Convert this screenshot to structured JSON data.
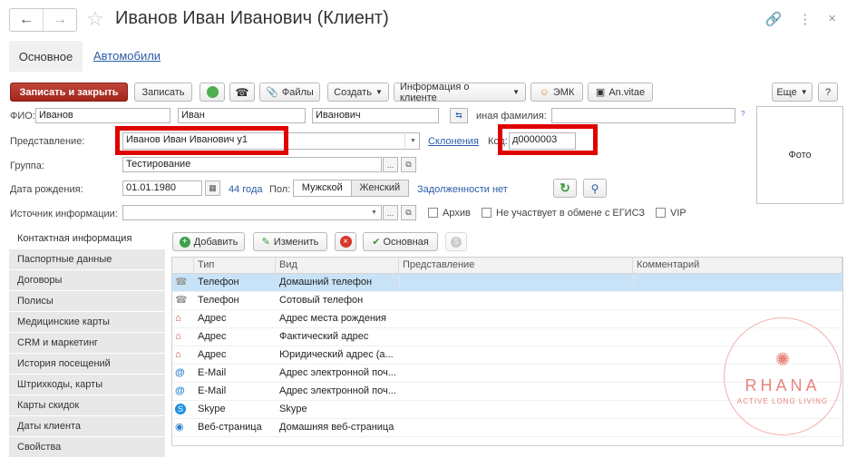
{
  "header": {
    "title": "Иванов Иван Иванович (Клиент)",
    "back_icon": "arrow-left",
    "forward_icon": "arrow-right",
    "favorite_icon": "star",
    "link_icon": "link",
    "more_icon": "vertical-dots",
    "close_icon": "close"
  },
  "tabs": {
    "main": "Основное",
    "cars": "Автомобили"
  },
  "toolbar": {
    "save_close": "Записать и закрыть",
    "save": "Записать",
    "files": "Файлы",
    "create": "Создать",
    "client_info": "Информация о клиенте",
    "emk": "ЭМК",
    "anvitae": "An.vitae",
    "more": "Еще",
    "help": "?"
  },
  "form": {
    "fio_label": "ФИО:",
    "last_name": "Иванов",
    "first_name": "Иван",
    "middle_name": "Иванович",
    "other_surname_label": "иная фамилия:",
    "other_surname_value": "",
    "hint": "?",
    "representation_label": "Представление:",
    "representation_value": "Иванов Иван Иванович у1",
    "declension_link": "Склонения",
    "code_label": "Код:",
    "code_value": "д0000003",
    "group_label": "Группа:",
    "group_value": "Тестирование",
    "birth_label": "Дата рождения:",
    "birth_value": "01.01.1980",
    "age": "44 года",
    "sex_label": "Пол:",
    "sex_male": "Мужской",
    "sex_female": "Женский",
    "debt_link": "Задолженности нет",
    "source_label": "Источник информации:",
    "source_value": "",
    "archive_label": "Архив",
    "egisz_label": "Не участвует в обмене с ЕГИСЗ",
    "vip_label": "VIP",
    "photo": "Фото"
  },
  "side_menu": [
    "Контактная информация",
    "Паспортные данные",
    "Договоры",
    "Полисы",
    "Медицинские карты",
    "CRM и маркетинг",
    "История посещений",
    "Штрихкоды, карты",
    "Карты скидок",
    "Даты клиента",
    "Свойства"
  ],
  "contact_toolbar": {
    "add": "Добавить",
    "edit": "Изменить",
    "main": "Основная"
  },
  "table": {
    "columns": [
      "Тип",
      "Вид",
      "Представление",
      "Комментарий"
    ],
    "rows": [
      {
        "icon": "phone",
        "type": "Телефон",
        "kind": "Домашний телефон",
        "repr": "",
        "comment": ""
      },
      {
        "icon": "phone",
        "type": "Телефон",
        "kind": "Сотовый телефон",
        "repr": "",
        "comment": ""
      },
      {
        "icon": "house",
        "type": "Адрес",
        "kind": "Адрес места рождения",
        "repr": "",
        "comment": ""
      },
      {
        "icon": "house",
        "type": "Адрес",
        "kind": "Фактический адрес",
        "repr": "",
        "comment": ""
      },
      {
        "icon": "house",
        "type": "Адрес",
        "kind": "Юридический адрес (а...",
        "repr": "",
        "comment": ""
      },
      {
        "icon": "at",
        "type": "E-Mail",
        "kind": "Адрес электронной поч...",
        "repr": "",
        "comment": ""
      },
      {
        "icon": "at",
        "type": "E-Mail",
        "kind": "Адрес электронной поч...",
        "repr": "",
        "comment": ""
      },
      {
        "icon": "skype",
        "type": "Skype",
        "kind": "Skype",
        "repr": "",
        "comment": ""
      },
      {
        "icon": "globe",
        "type": "Веб-страница",
        "kind": "Домашняя веб-страница",
        "repr": "",
        "comment": ""
      }
    ]
  },
  "watermark": {
    "name": "RHANA",
    "tagline": "ACTIVE LONG LIVING"
  },
  "colors": {
    "primary_button": "#a1261b",
    "link": "#2a5ca8",
    "highlight_box": "#e00000",
    "selected_row": "#c8e3f7"
  }
}
